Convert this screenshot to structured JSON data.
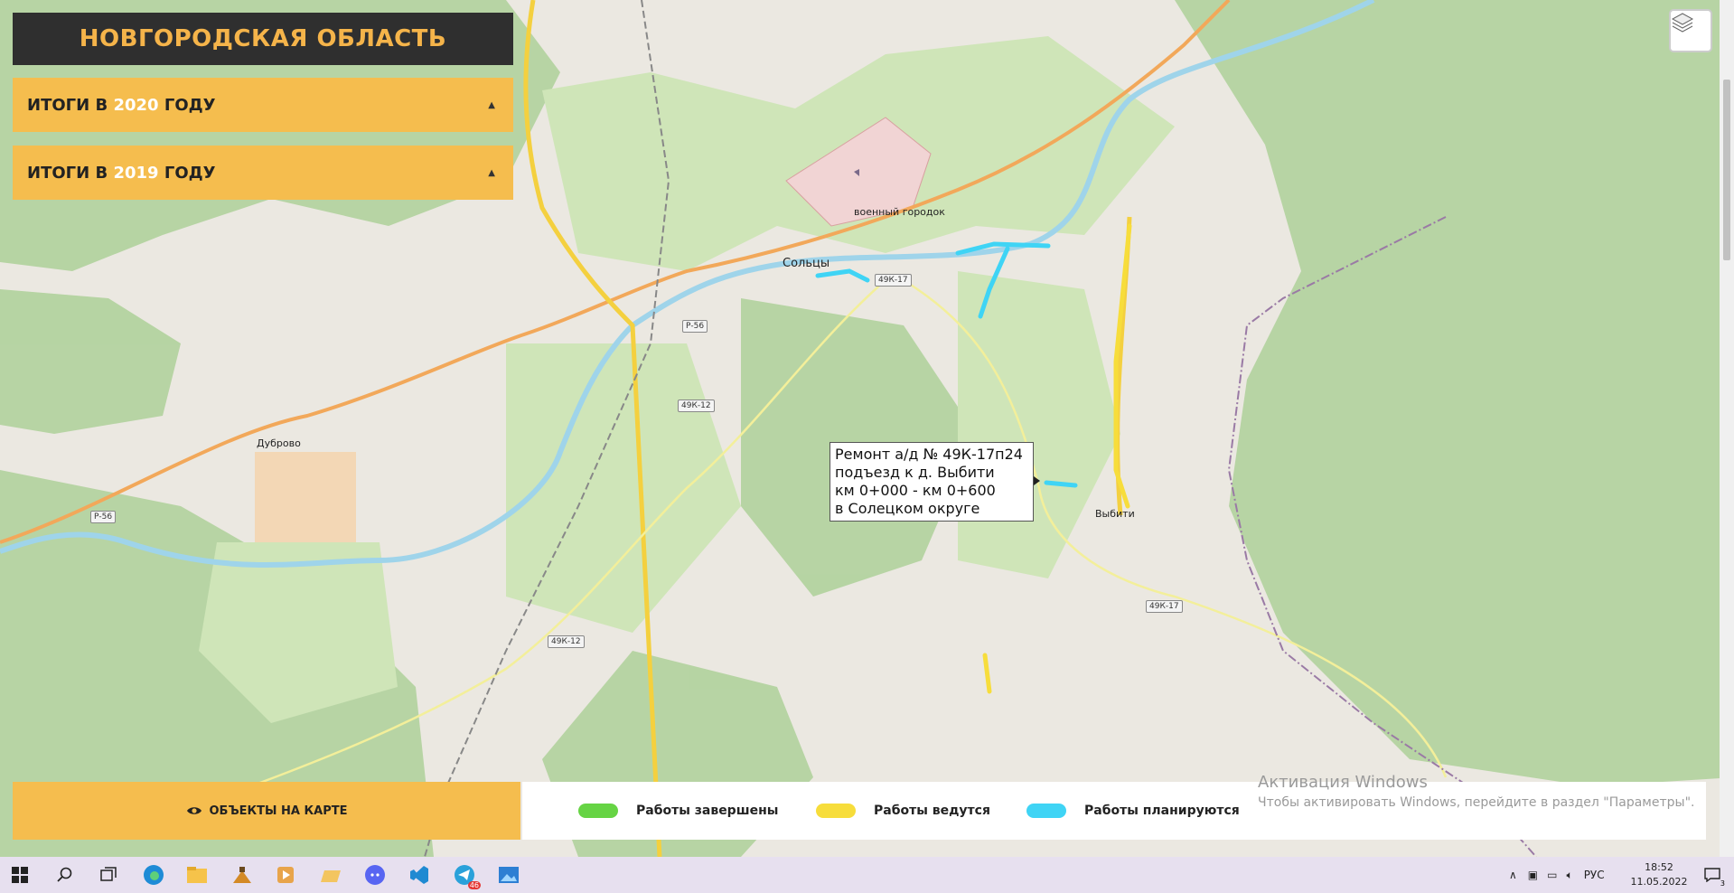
{
  "header": {
    "title": "НОВГОРОДСКАЯ ОБЛАСТЬ"
  },
  "accordion": [
    {
      "prefix": "ИТОГИ В ",
      "year": "2020",
      "suffix": " ГОДУ",
      "caret": "▲"
    },
    {
      "prefix": "ИТОГИ В ",
      "year": "2019",
      "suffix": " ГОДУ",
      "caret": "▲"
    }
  ],
  "tooltip": {
    "lines": [
      "Ремонт а/д № 49К-17п24",
      "подъезд к д. Выбити",
      "км 0+000 - км 0+600",
      "в Солецком округе"
    ]
  },
  "map_labels": {
    "city": "Сольцы",
    "town1": "военный городок",
    "village1": "Дуброво",
    "village2": "Выбити"
  },
  "road_shields": [
    "49К-17",
    "Р-56",
    "49К-12",
    "Р-56",
    "49К-12",
    "49К-17"
  ],
  "objects_button": {
    "label": "ОБЪЕКТЫ НА КАРТЕ",
    "icon": "eye-icon"
  },
  "legend": [
    {
      "label": "Работы завершены",
      "color": "#66d444"
    },
    {
      "label": "Работы ведутся",
      "color": "#f7dd3b"
    },
    {
      "label": "Работы планируются",
      "color": "#3fd4f5"
    }
  ],
  "watermark": {
    "line1": "Активация Windows",
    "line2": "Чтобы активировать Windows, перейдите в раздел \"Параметры\"."
  },
  "tray": {
    "lang": "РУС",
    "time": "18:52",
    "date": "11.05.2022",
    "notifications": "3"
  },
  "taskbar_icons": [
    "windows-start-icon",
    "search-icon",
    "task-view-icon",
    "edge-icon",
    "file-explorer-icon",
    "app-icon",
    "media-icon",
    "folder-icon",
    "discord-icon",
    "vscode-icon",
    "telegram-icon",
    "photos-icon"
  ],
  "telegram_badge": "46"
}
